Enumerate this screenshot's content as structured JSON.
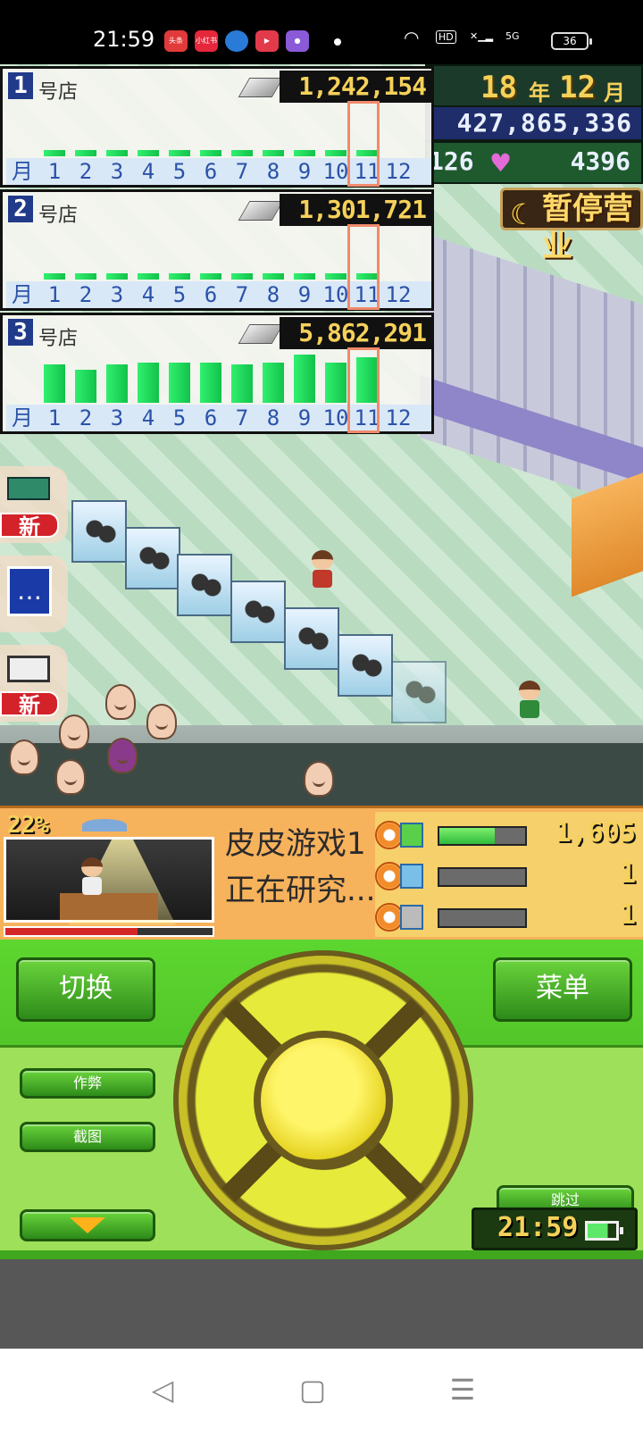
{
  "status_bar": {
    "time": "21:59",
    "app_icons": [
      {
        "name": "toutiao",
        "label": "头条",
        "color": "#e23a3a"
      },
      {
        "name": "xiaohongshu",
        "label": "小红书",
        "color": "#e6263a"
      },
      {
        "name": "app-blue",
        "label": "",
        "color": "#2a7ad8"
      },
      {
        "name": "video",
        "label": "",
        "color": "#e23a4a"
      },
      {
        "name": "app-purple",
        "label": "",
        "color": "#8a5ad8"
      }
    ],
    "hd_label": "HD",
    "network": "5G",
    "battery": "36"
  },
  "hud": {
    "year": "18",
    "year_unit": "年",
    "month": "12",
    "month_unit": "月",
    "funds": "427,865,336",
    "research_points": "126",
    "fans": "4396",
    "pause_label": "暂停营业"
  },
  "stores": [
    {
      "number": "1",
      "label": "号店",
      "sales": "1,242,154",
      "month_values": [
        7,
        7,
        7,
        7,
        7,
        7,
        7,
        7,
        7,
        7,
        7,
        0
      ],
      "current_month": 11
    },
    {
      "number": "2",
      "label": "号店",
      "sales": "1,301,721",
      "month_values": [
        7,
        7,
        7,
        7,
        7,
        7,
        7,
        7,
        7,
        7,
        7,
        0
      ],
      "current_month": 11
    },
    {
      "number": "3",
      "label": "号店",
      "sales": "5,862,291",
      "month_values": [
        44,
        38,
        44,
        47,
        47,
        47,
        44,
        47,
        56,
        47,
        53,
        0
      ],
      "current_month": 11
    }
  ],
  "months_axis": {
    "unit": "月",
    "labels": [
      "1",
      "2",
      "3",
      "4",
      "5",
      "6",
      "7",
      "8",
      "9",
      "10",
      "11",
      "12"
    ]
  },
  "side_buttons": [
    {
      "name": "new-item",
      "badge": "新"
    },
    {
      "name": "message",
      "badge": ""
    },
    {
      "name": "computer",
      "badge": "新"
    }
  ],
  "research": {
    "percent": "22%",
    "progress_fraction": 0.64,
    "line1": "皮皮游戏1",
    "line2": "正在研究...",
    "rows": [
      {
        "value": "1,605",
        "bar_fraction": 0.65
      },
      {
        "value": "1",
        "bar_fraction": 0
      },
      {
        "value": "1",
        "bar_fraction": 0
      }
    ]
  },
  "controller": {
    "switch_label": "切换",
    "menu_label": "菜单",
    "cheat_label": "作弊",
    "screenshot_label": "截图",
    "skip_label": "跳过",
    "clock": "21:59"
  },
  "nav": {
    "back": "◁",
    "home": "▢",
    "menu": "☰"
  }
}
